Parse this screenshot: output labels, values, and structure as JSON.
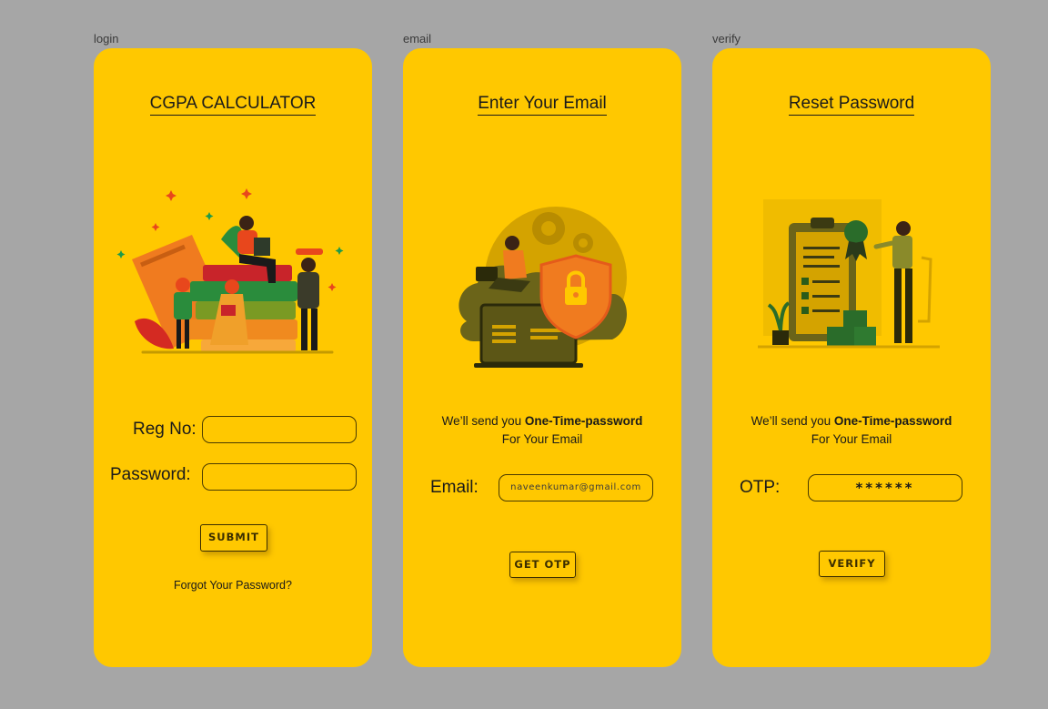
{
  "frames": [
    {
      "label": "login",
      "title": "CGPA CALCULATOR",
      "reg_label": "Reg No:",
      "password_label": "Password:",
      "submit_label": "SUBMIT",
      "forgot_link": "Forgot Your Password?"
    },
    {
      "label": "email",
      "title": "Enter Your Email",
      "msg_prefix": "We’ll send you ",
      "msg_bold": "One-Time-password",
      "msg_line2": "For Your Email",
      "email_label": "Email:",
      "email_value": "naveenkumar@gmail.com",
      "button_label": "GET OTP"
    },
    {
      "label": "verify",
      "title": "Reset Password",
      "msg_prefix": "We’ll send you ",
      "msg_bold": "One-Time-password",
      "msg_line2": "For Your Email",
      "otp_label": "OTP:",
      "otp_value": "******",
      "button_label": "VERIFY"
    }
  ],
  "colors": {
    "background": "#a6a6a6",
    "card": "#ffc800",
    "text": "#1a1a1a",
    "accent_orange": "#f47a20",
    "accent_green": "#2e7d32"
  }
}
